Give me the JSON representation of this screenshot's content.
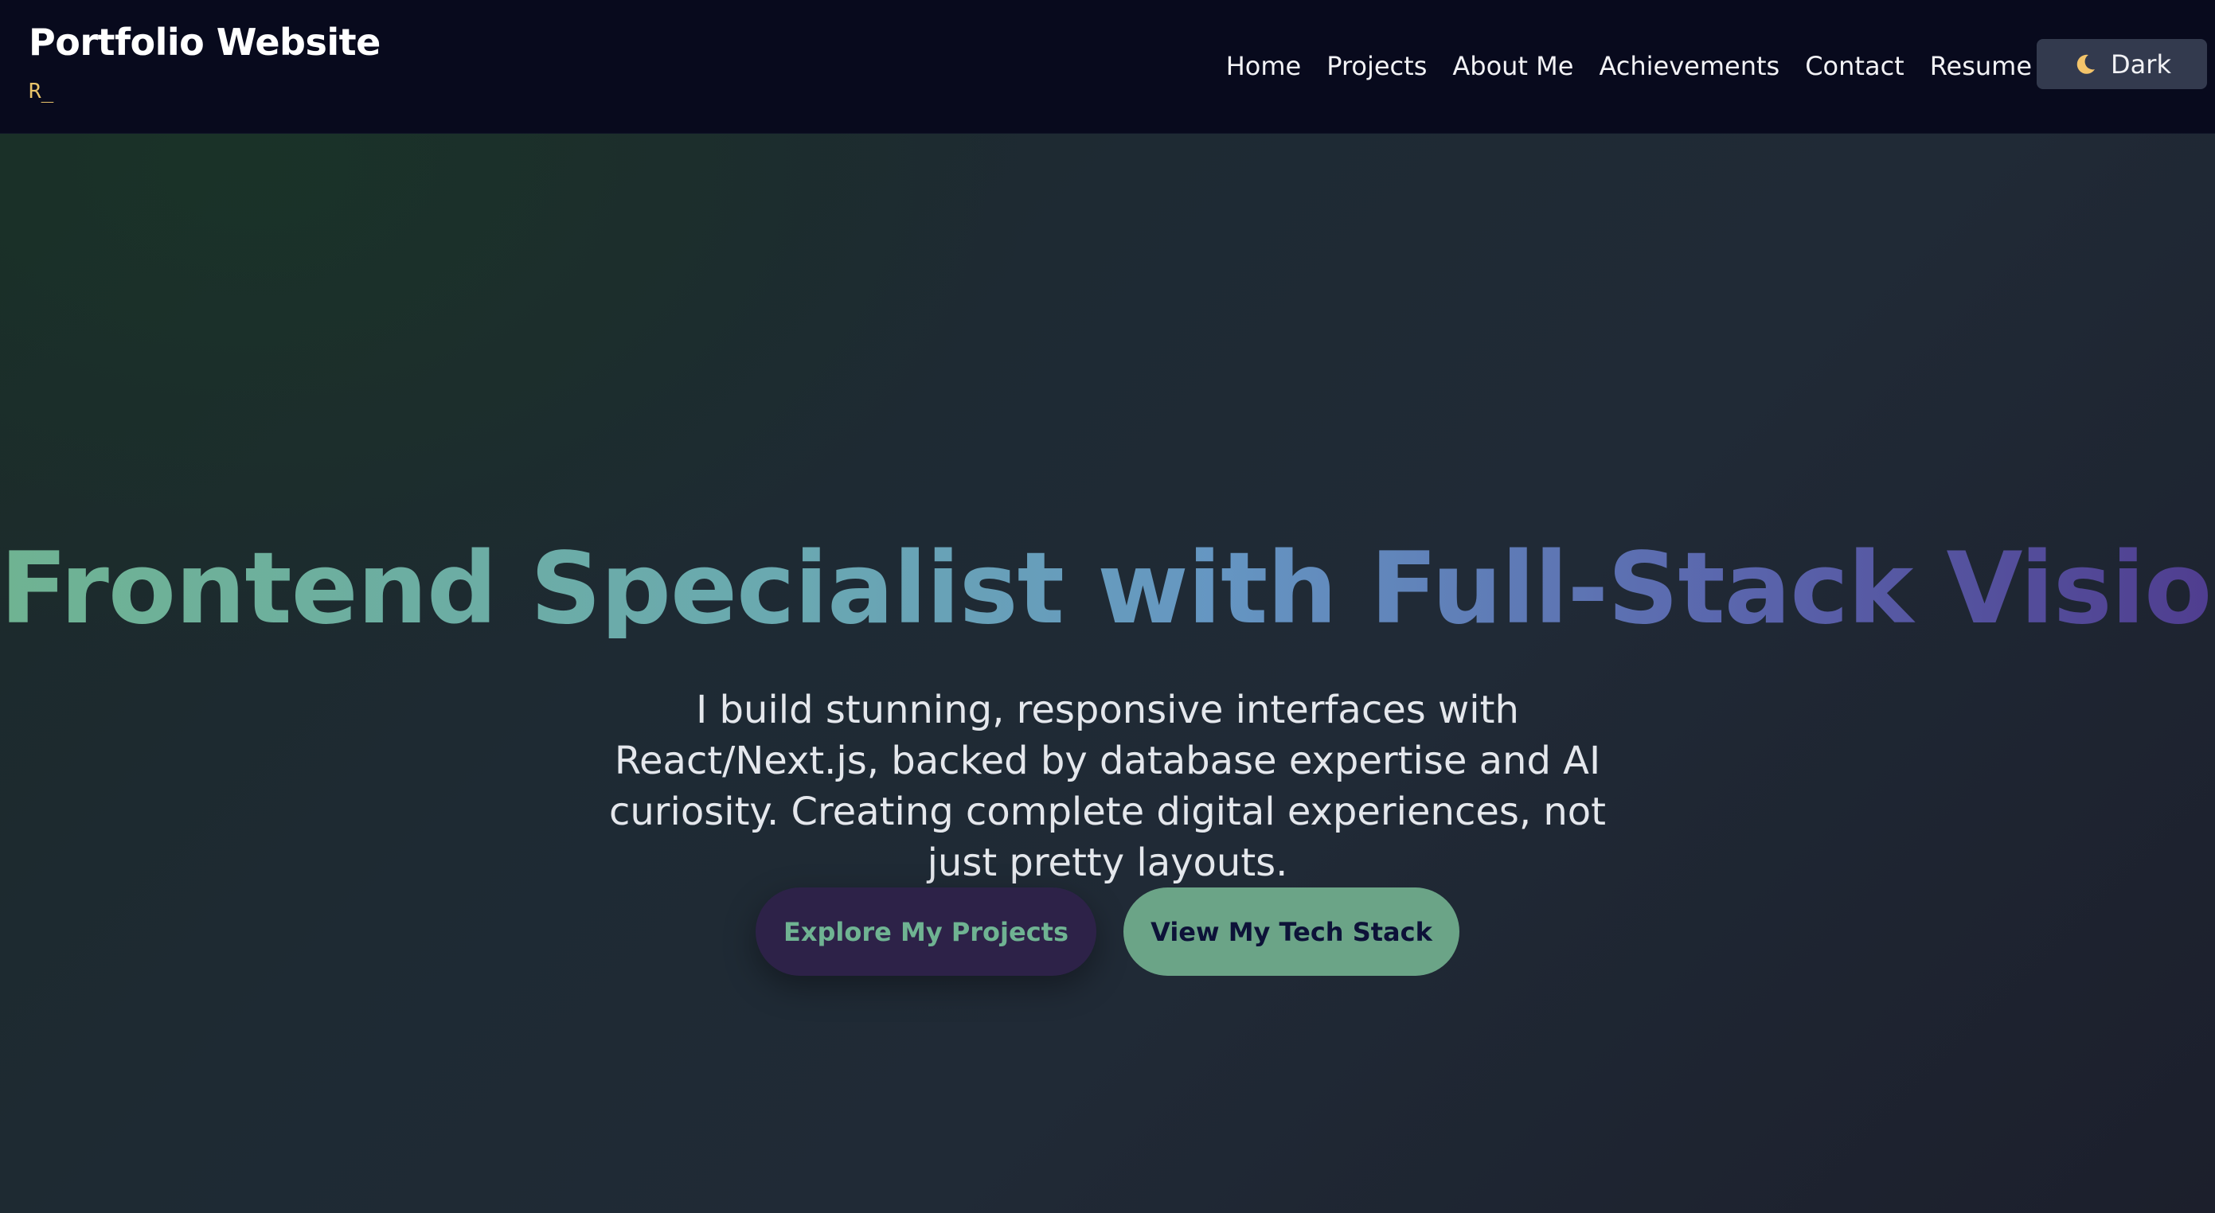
{
  "brand": {
    "title": "Portfolio Website",
    "subtitle": "R_"
  },
  "nav": {
    "links": [
      "Home",
      "Projects",
      "About Me",
      "Achievements",
      "Contact",
      "Resume"
    ],
    "theme_toggle": {
      "icon": "moon-icon",
      "label": "Dark"
    }
  },
  "hero": {
    "title": "Frontend Specialist with Full-Stack Vision",
    "description": "I build stunning, responsive interfaces with React/Next.js, backed by database expertise and AI curiosity. Creating complete digital experiences, not just pretty layouts.",
    "primary_button": "Explore My Projects",
    "secondary_button": "View My Tech Stack"
  },
  "colors": {
    "nav_background": "#080a1d",
    "accent_green": "#6fb392",
    "accent_purple": "#4f3d8f",
    "subtitle_yellow": "#e9c46a",
    "primary_button_bg": "#2d2248",
    "secondary_button_bg": "#6ba487"
  }
}
